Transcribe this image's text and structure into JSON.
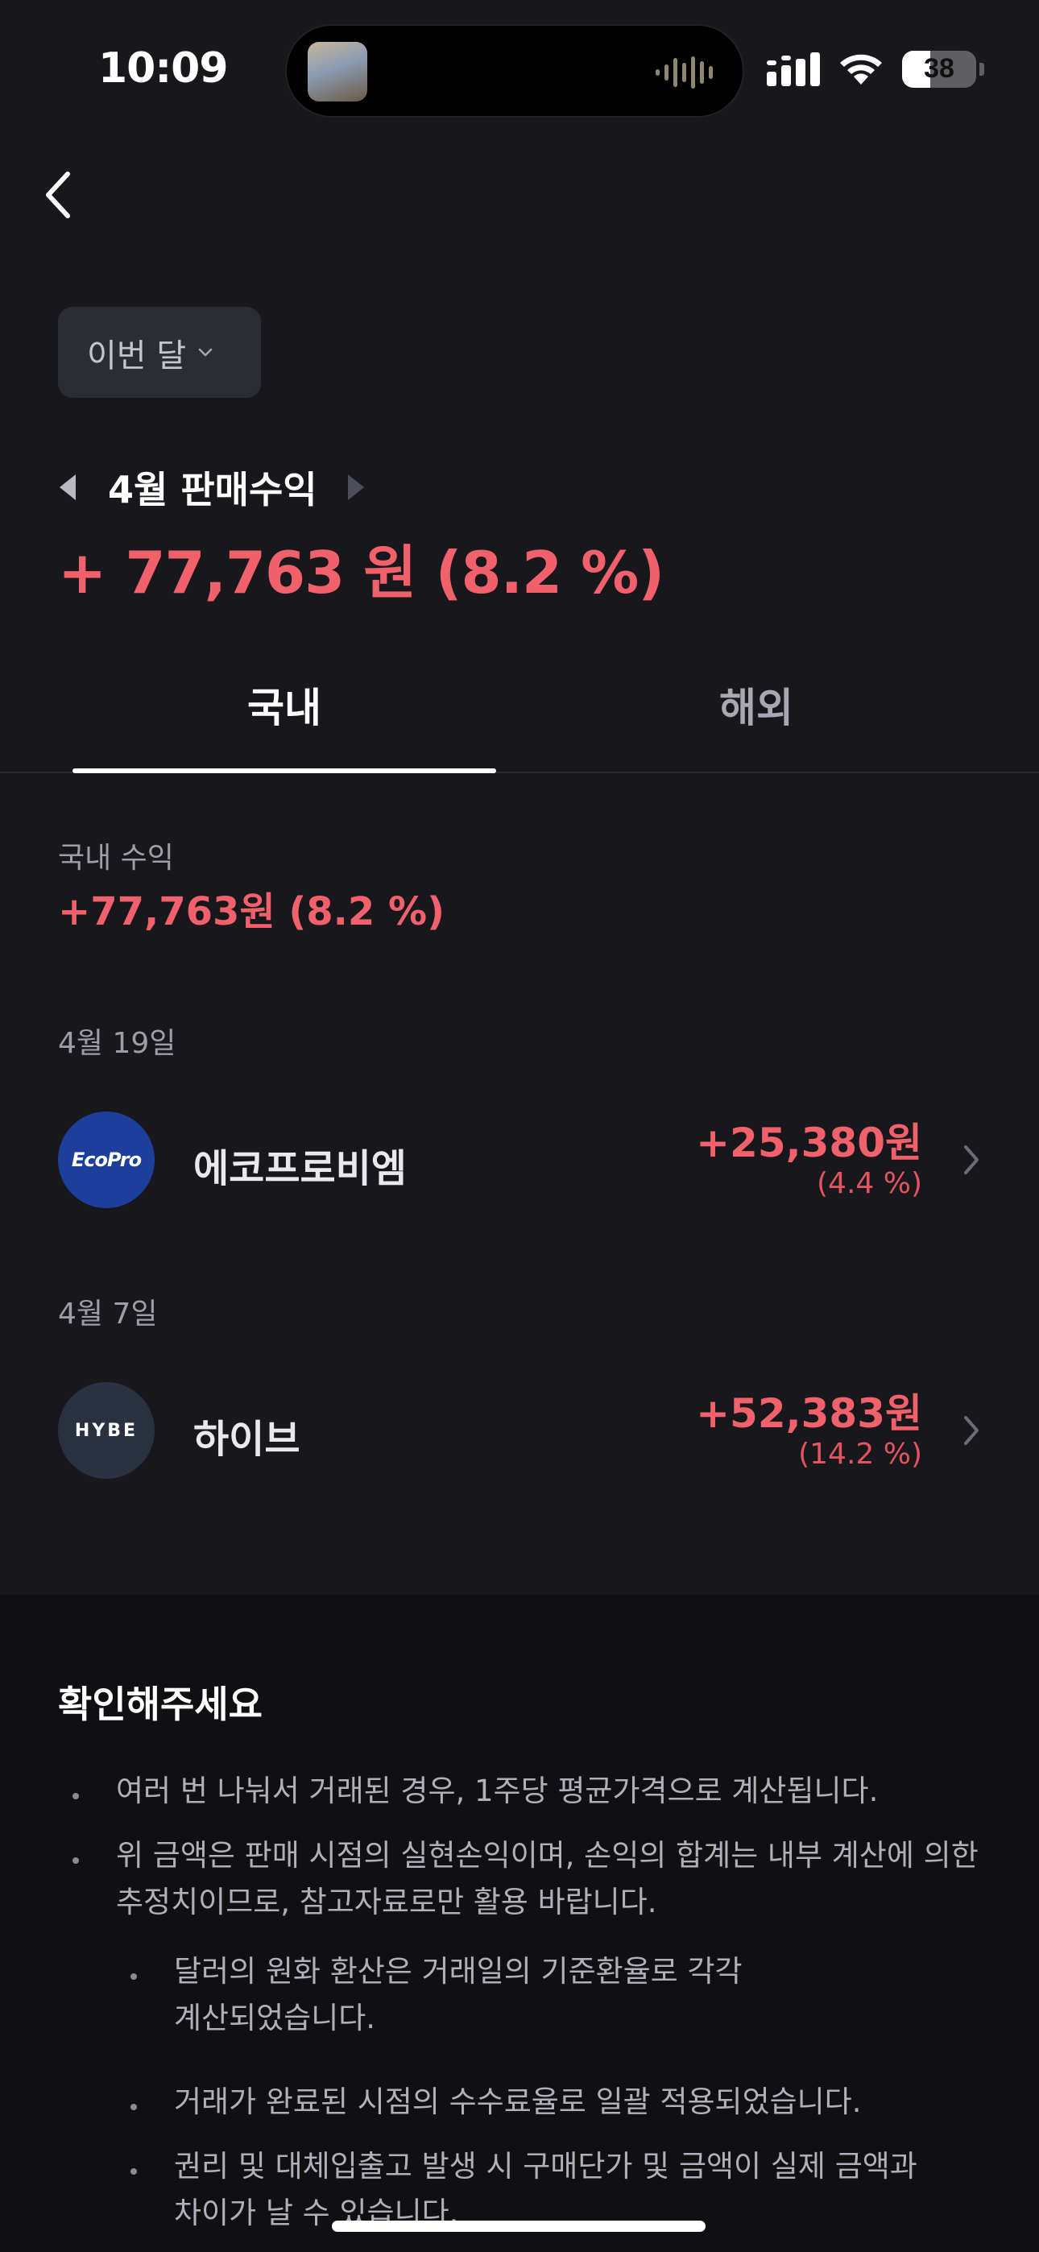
{
  "status_bar": {
    "time": "10:09",
    "battery": "38"
  },
  "filter": {
    "period_label": "이번 달"
  },
  "header": {
    "month_title": "4월 판매수익",
    "total_amount": "+ 77,763 원 (8.2 %)"
  },
  "tabs": [
    {
      "label": "국내",
      "selected": true
    },
    {
      "label": "해외",
      "selected": false
    }
  ],
  "summary": {
    "label": "국내 수익",
    "value": "+77,763원 (8.2 %)"
  },
  "trades": [
    {
      "date": "4월 19일",
      "logo_text": "EcoPro",
      "name": "에코프로비엠",
      "amount": "+25,380원",
      "percent": "(4.4 %)"
    },
    {
      "date": "4월 7일",
      "logo_text": "HYBE",
      "name": "하이브",
      "amount": "+52,383원",
      "percent": "(14.2 %)"
    }
  ],
  "notice": {
    "title": "확인해주세요",
    "items": [
      "여러 번 나눠서 거래된 경우, 1주당 평균가격으로 계산됩니다.",
      "위 금액은 판매 시점의 실현손익이며, 손익의 합계는 내부 계산에 의한",
      "추정치이므로, 참고자료로만 활용 바랍니다."
    ],
    "sub_items": [
      "달러의 원화 환산은 거래일의 기준환율로 각각",
      "계산되었습니다.",
      "거래가 완료된 시점의 수수료율로 일괄 적용되었습니다.",
      "권리 및 대체입출고 발생 시 구매단가 및 금액이 실제 금액과",
      "차이가 날 수 있습니다."
    ]
  },
  "colors": {
    "profit": "#f0616b",
    "background": "#17171c",
    "notice_bg": "#101013"
  }
}
